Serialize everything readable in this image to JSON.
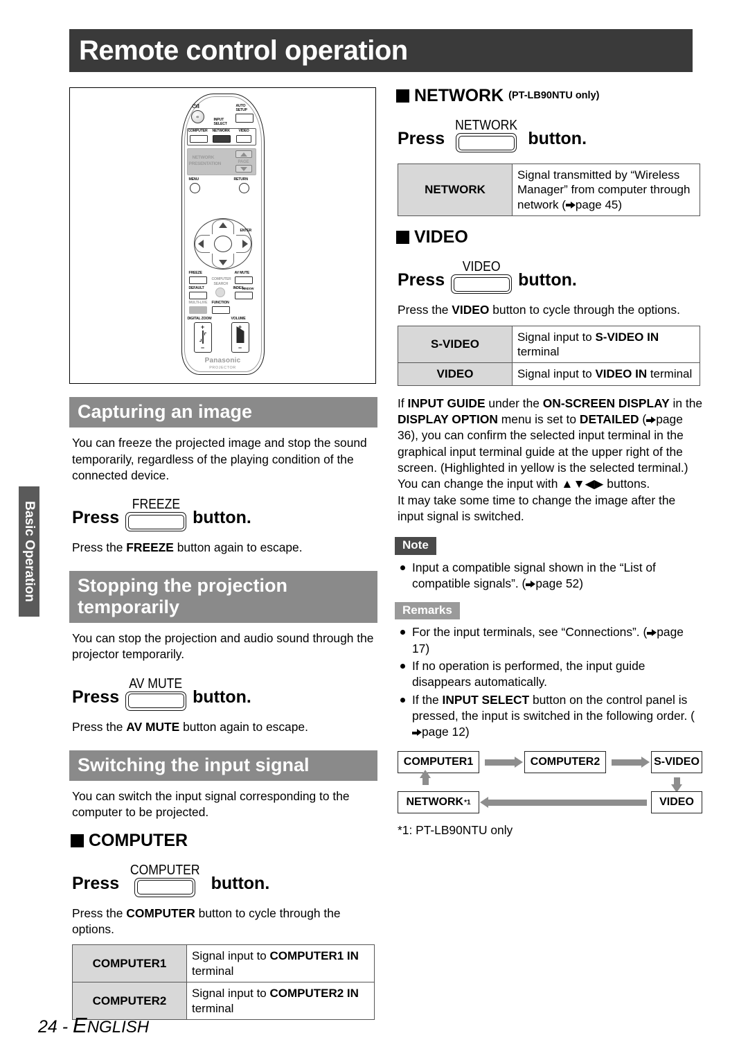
{
  "page": {
    "title": "Remote control operation",
    "side_tab": "Basic Operation",
    "footer_page": "24 - ",
    "footer_lang_first": "E",
    "footer_lang_rest": "NGLISH"
  },
  "remote": {
    "labels": {
      "power": "⏻/I",
      "auto_setup": "AUTO\nSETUP",
      "auto_setup_l1": "AUTO",
      "auto_setup_l2": "SETUP",
      "input_select_l1": "INPUT",
      "input_select_l2": "SELECT",
      "computer": "COMPUTER",
      "network": "NETWORK",
      "video": "VIDEO",
      "network_presentation_l1": "NETWORK",
      "network_presentation_l2": "PRESENTATION",
      "page": "PAGE",
      "menu": "MENU",
      "return": "RETURN",
      "enter": "ENTER",
      "freeze": "FREEZE",
      "av_mute": "AV MUTE",
      "default": "DEFAULT",
      "computer_search_l1": "COMPUTER",
      "computer_search_l2": "SEARCH",
      "index_window_a": "INDEX-",
      "index_window_b": "WINDOW",
      "multilive": "MULTI-LIVE",
      "function": "FUNCTION",
      "digital_zoom": "DIGITAL ZOOM",
      "volume": "VOLUME",
      "brand": "Panasonic",
      "brand_sub": "PROJECTOR"
    }
  },
  "left": {
    "capturing": {
      "heading": "Capturing an image",
      "body": "You can freeze the projected image and stop the sound temporarily, regardless of the playing condition of the connected device.",
      "press_word": "Press",
      "button_word": "button.",
      "key_label": "FREEZE",
      "after_1": "Press the ",
      "after_bold": "FREEZE",
      "after_2": " button again to escape."
    },
    "stopping": {
      "heading_l1": "Stopping the projection",
      "heading_l2": "temporarily",
      "body": "You can stop the projection and audio sound through the projector temporarily.",
      "press_word": "Press",
      "button_word": "button.",
      "key_label": "AV MUTE",
      "after_1": "Press the ",
      "after_bold": "AV MUTE",
      "after_2": " button again to escape."
    },
    "switching": {
      "heading": "Switching the input signal",
      "body": "You can switch the input signal corresponding to the computer to be projected.",
      "sub_heading": "COMPUTER",
      "press_word": "Press",
      "button_word": "button.",
      "key_label": "COMPUTER",
      "after_1": "Press the ",
      "after_bold": "COMPUTER",
      "after_2": " button to cycle through the options.",
      "table": [
        {
          "key": "COMPUTER1",
          "val_pre": "Signal input to ",
          "val_bold": "COMPUTER1 IN",
          "val_post": " terminal"
        },
        {
          "key": "COMPUTER2",
          "val_pre": "Signal input to ",
          "val_bold": "COMPUTER2 IN",
          "val_post": " terminal"
        }
      ]
    }
  },
  "right": {
    "network": {
      "sub_heading": "NETWORK",
      "sub_note": "(PT-LB90NTU only)",
      "press_word": "Press",
      "button_word": "button.",
      "key_label": "NETWORK",
      "table": [
        {
          "key": "NETWORK",
          "val_pre": "Signal transmitted by “Wireless Manager” from computer through network (",
          "val_link": "page 45",
          "val_post": ")"
        }
      ]
    },
    "video": {
      "sub_heading": "VIDEO",
      "press_word": "Press",
      "button_word": "button.",
      "key_label": "VIDEO",
      "after_1": "Press the ",
      "after_bold": "VIDEO",
      "after_2": " button to cycle through the options.",
      "table": [
        {
          "key": "S-VIDEO",
          "val_pre": "Signal input to ",
          "val_bold": "S-VIDEO IN",
          "val_post": " terminal"
        },
        {
          "key": "VIDEO",
          "val_pre": "Signal input to ",
          "val_bold": "VIDEO IN",
          "val_post": " terminal"
        }
      ]
    },
    "guide_paragraph": {
      "p1_a": "If ",
      "p1_b": "INPUT GUIDE",
      "p1_c": " under the ",
      "p1_d": "ON-SCREEN DISPLAY",
      "p1_e": " in the ",
      "p1_f": "DISPLAY OPTION",
      "p1_g": " menu is set to ",
      "p1_h": "DETAILED",
      "p1_i": " (",
      "p1_link": "page 36",
      "p1_j": "), you can confirm the selected input terminal in the graphical input terminal guide at the upper right of the screen. (Highlighted in yellow is the selected terminal.)",
      "p2_a": "You can change the input with ",
      "p2_arrows": "▲▼◀▶",
      "p2_b": " buttons.",
      "p3": "It may take some time to change the image after the input signal is switched."
    },
    "note": {
      "badge": "Note",
      "items": [
        {
          "pre": "Input a compatible signal shown in the “List of compatible signals”. (",
          "link": "page 52",
          "post": ")"
        }
      ]
    },
    "remarks": {
      "badge": "Remarks",
      "items": [
        {
          "pre": "For the input terminals, see “Connections”. (",
          "link": "page 17",
          "post": ")"
        },
        {
          "pre": "If no operation is performed, the input guide disappears automatically.",
          "link": "",
          "post": ""
        },
        {
          "pre_a": "If the ",
          "bold": "INPUT SELECT",
          "pre_b": " button on the control panel is pressed, the input is switched in the following order. (",
          "link": "page 12",
          "post": ")"
        }
      ]
    },
    "flow": {
      "nodes": [
        "COMPUTER1",
        "COMPUTER2",
        "S-VIDEO",
        "VIDEO",
        "NETWORK "
      ],
      "network_sup": "*1",
      "footnote": "*1:  PT-LB90NTU only"
    }
  },
  "colors": {
    "title_bar": "#3a3a3a",
    "section_head": "#8a8a8a",
    "side_tab": "#5a5a5a",
    "table_key": "#d8d8d8",
    "note_badge": "#4a4a4a",
    "remarks_badge": "#9a9a9a",
    "arrow_gray": "#8d8d8d"
  }
}
